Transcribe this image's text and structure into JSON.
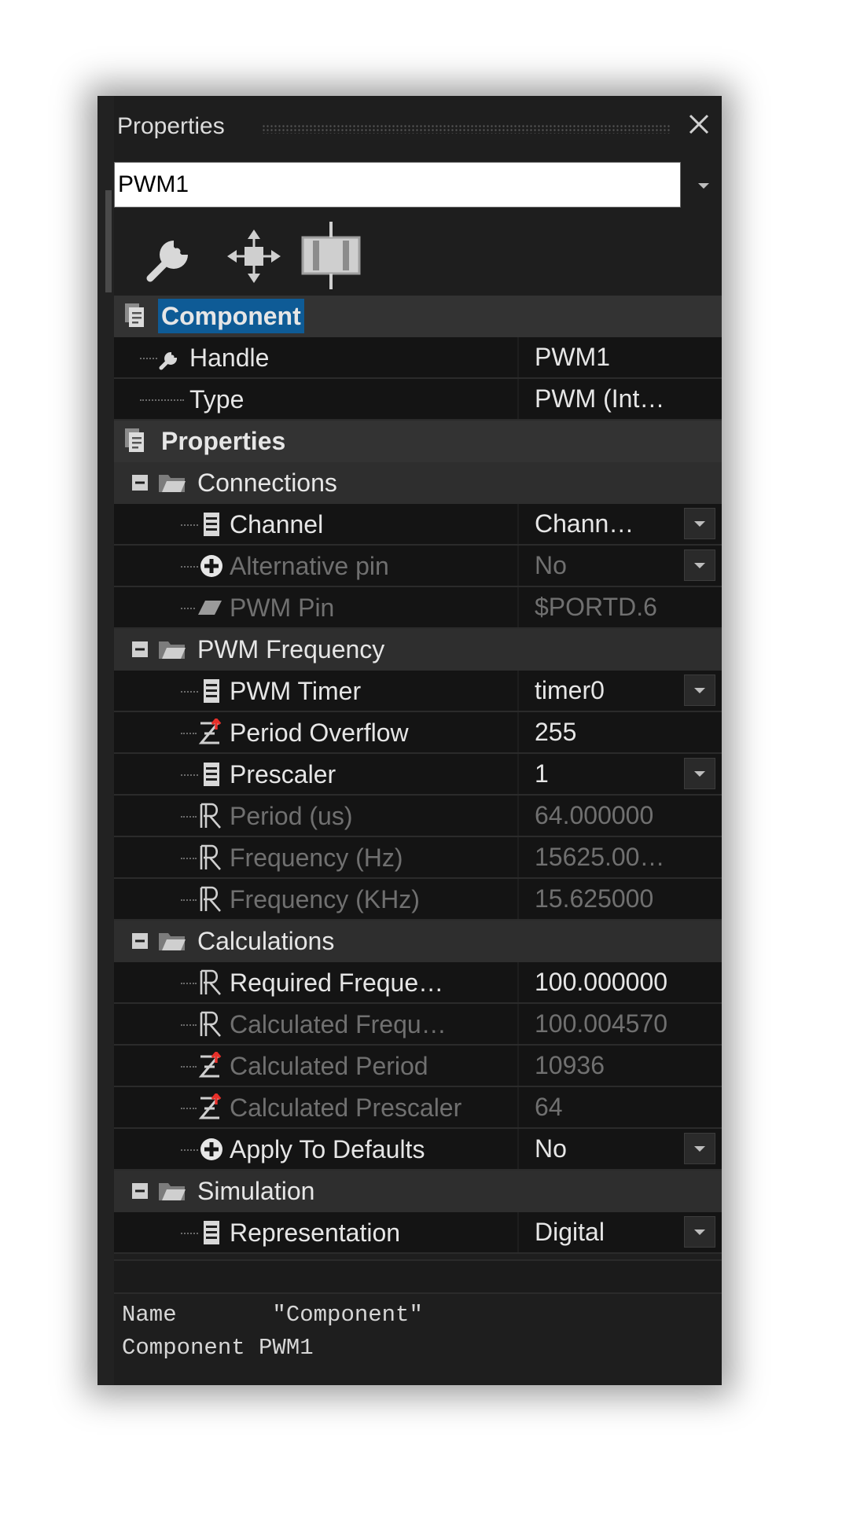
{
  "panel": {
    "title": "Properties",
    "selected_object": "PWM1"
  },
  "toolbar": {
    "tools": [
      "wrench-icon",
      "move-icon",
      "component-icon"
    ]
  },
  "sections": {
    "component": {
      "label": "Component",
      "handle": {
        "name": "Handle",
        "value": "PWM1"
      },
      "type": {
        "name": "Type",
        "value": "PWM (Int…"
      }
    },
    "properties": {
      "label": "Properties"
    },
    "connections": {
      "label": "Connections",
      "channel": {
        "name": "Channel",
        "value": "Chann…"
      },
      "alternative_pin": {
        "name": "Alternative pin",
        "value": "No"
      },
      "pwm_pin": {
        "name": "PWM Pin",
        "value": "$PORTD.6"
      }
    },
    "pwm_frequency": {
      "label": "PWM Frequency",
      "pwm_timer": {
        "name": "PWM Timer",
        "value": "timer0"
      },
      "period_overflow": {
        "name": "Period Overflow",
        "value": "255"
      },
      "prescaler": {
        "name": "Prescaler",
        "value": "1"
      },
      "period_us": {
        "name": "Period (us)",
        "value": "64.000000"
      },
      "frequency_hz": {
        "name": "Frequency (Hz)",
        "value": "15625.00…"
      },
      "frequency_khz": {
        "name": "Frequency (KHz)",
        "value": "15.625000"
      }
    },
    "calculations": {
      "label": "Calculations",
      "required_frequency": {
        "name": "Required Freque…",
        "value": "100.000000"
      },
      "calculated_frequency": {
        "name": "Calculated Frequ…",
        "value": "100.004570"
      },
      "calculated_period": {
        "name": "Calculated Period",
        "value": "10936"
      },
      "calculated_prescaler": {
        "name": "Calculated Prescaler",
        "value": "64"
      },
      "apply_to_defaults": {
        "name": "Apply To Defaults",
        "value": "No"
      }
    },
    "simulation": {
      "label": "Simulation",
      "representation": {
        "name": "Representation",
        "value": "Digital"
      }
    }
  },
  "description": {
    "line1": "Name       \"Component\"",
    "line2": "Component PWM1"
  },
  "colors": {
    "background": "#1e1e1e",
    "selection": "#0e5b96",
    "text": "#e6e6e6",
    "disabled_text": "#707070"
  }
}
